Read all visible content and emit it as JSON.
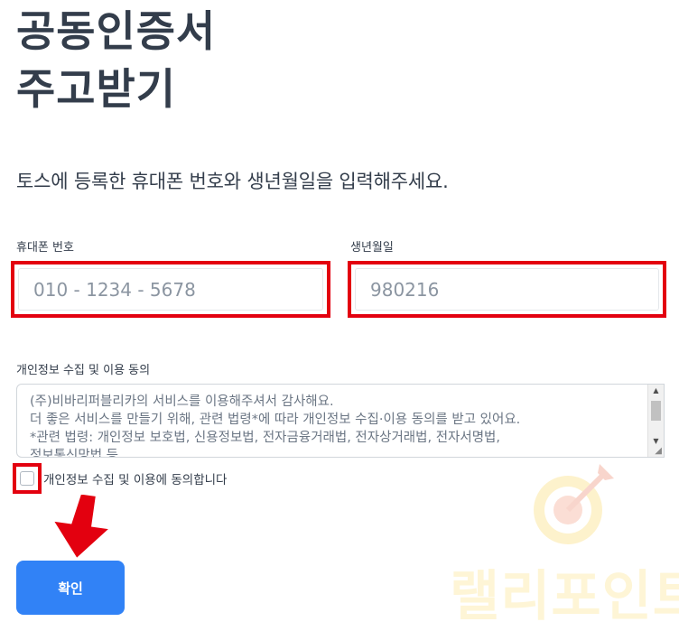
{
  "title": {
    "line1": "공동인증서",
    "line2": "주고받기"
  },
  "subtitle": "토스에 등록한 휴대폰 번호와 생년월일을 입력해주세요.",
  "phone": {
    "label": "휴대폰 번호",
    "placeholder": "010 - 1234 - 5678"
  },
  "birth": {
    "label": "생년월일",
    "placeholder": "980216"
  },
  "consent": {
    "label": "개인정보 수집 및 이용 동의",
    "text": "(주)비바리퍼블리카의 서비스를 이용해주셔서 감사해요.\n더 좋은 서비스를 만들기 위해, 관련 법령*에 따라 개인정보 수집·이용 동의를 받고 있어요.\n*관련 법령: 개인정보 보호법, 신용정보법, 전자금융거래법, 전자상거래법, 전자서명법,\n정보통신망법 등",
    "checkbox_label": "개인정보 수집 및 이용에 동의합니다",
    "checked": false
  },
  "confirm_label": "확인",
  "watermark": {
    "text": "랠리포인트",
    "icon": "target-arrow-icon"
  },
  "colors": {
    "highlight": "#e3000f",
    "primary": "#3182f6",
    "text": "#333d4b",
    "placeholder": "#8b95a1",
    "watermark": "#fbd34a"
  }
}
